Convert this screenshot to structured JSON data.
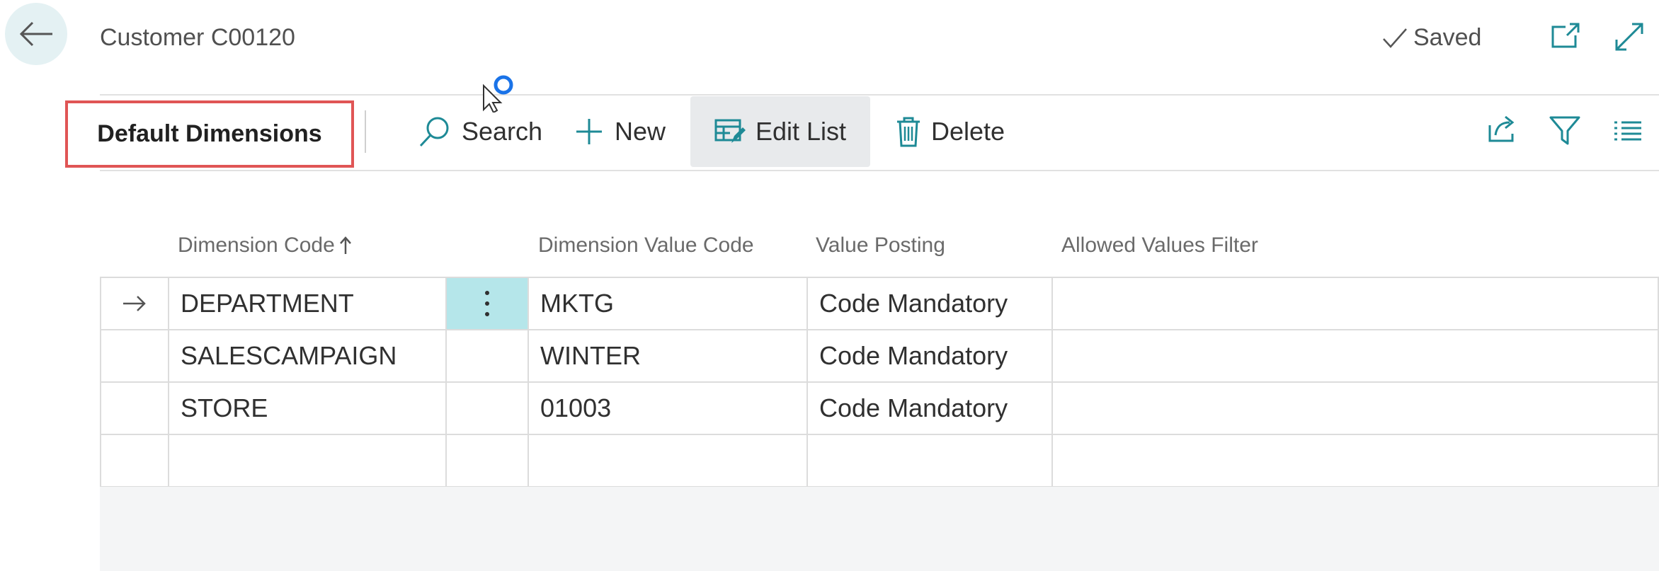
{
  "header": {
    "title": "Customer C00120",
    "saved_label": "Saved"
  },
  "action_bar": {
    "tab_title": "Default Dimensions",
    "search_label": "Search",
    "new_label": "New",
    "edit_list_label": "Edit List",
    "delete_label": "Delete"
  },
  "table": {
    "columns": {
      "dimension_code": "Dimension Code",
      "dimension_value_code": "Dimension Value Code",
      "value_posting": "Value Posting",
      "allowed_values_filter": "Allowed Values Filter"
    },
    "rows": [
      {
        "dimension_code": "DEPARTMENT",
        "dimension_value_code": "MKTG",
        "value_posting": "Code Mandatory",
        "allowed_values_filter": ""
      },
      {
        "dimension_code": "SALESCAMPAIGN",
        "dimension_value_code": "WINTER",
        "value_posting": "Code Mandatory",
        "allowed_values_filter": ""
      },
      {
        "dimension_code": "STORE",
        "dimension_value_code": "01003",
        "value_posting": "Code Mandatory",
        "allowed_values_filter": ""
      },
      {
        "dimension_code": "",
        "dimension_value_code": "",
        "value_posting": "",
        "allowed_values_filter": ""
      }
    ]
  },
  "colors": {
    "accent": "#1e8a96",
    "highlight_box": "#e05555",
    "selected_cell": "#b5e6ea"
  },
  "icons": {
    "back": "arrow-left-icon",
    "saved": "checkmark-icon",
    "open_new_window": "open-in-new-window-icon",
    "expand": "expand-icon",
    "search": "search-icon",
    "new": "plus-icon",
    "edit_list": "edit-list-icon",
    "delete": "trash-icon",
    "share": "share-icon",
    "filter": "filter-icon",
    "list_view": "list-view-icon",
    "row_indicator": "arrow-right-icon",
    "row_menu": "more-vertical-icon"
  }
}
